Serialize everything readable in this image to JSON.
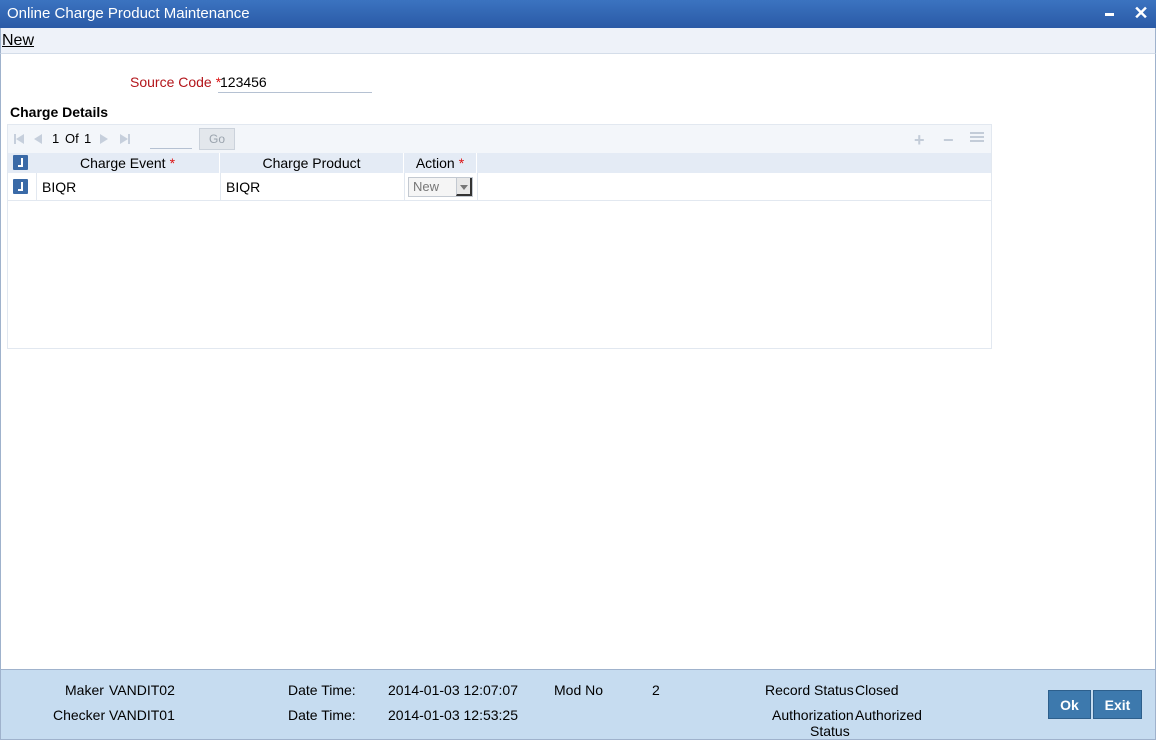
{
  "window": {
    "title": "Online Charge Product Maintenance"
  },
  "menu": {
    "new_label": "New"
  },
  "form": {
    "source_code_label": "Source Code",
    "source_code_value": "123456",
    "required_mark": "*"
  },
  "charge_details": {
    "section_title": "Charge Details",
    "pager": {
      "current": "1",
      "of_label": "Of",
      "total": "1",
      "go_label": "Go"
    },
    "columns": [
      "Charge Event",
      "Charge Product",
      "Action"
    ],
    "rows": [
      {
        "charge_event": "BIQR",
        "charge_product": "BIQR",
        "action": "New"
      }
    ]
  },
  "footer": {
    "maker_label": "Maker",
    "maker_value": "VANDIT02",
    "checker_label": "Checker",
    "checker_value": "VANDIT01",
    "datetime_label": "Date Time:",
    "maker_datetime": "2014-01-03 12:07:07",
    "checker_datetime": "2014-01-03 12:53:25",
    "mod_no_label": "Mod No",
    "mod_no_value": "2",
    "record_status_label": "Record Status",
    "record_status_value": "Closed",
    "auth_status_label_1": "Authorization",
    "auth_status_label_2": "Status",
    "auth_status_value": "Authorized",
    "ok_label": "Ok",
    "exit_label": "Exit"
  },
  "colors": {
    "titlebar": "#2f63b0",
    "footer": "#c6dcf0",
    "button": "#3d79ad",
    "required": "#b3151b"
  }
}
